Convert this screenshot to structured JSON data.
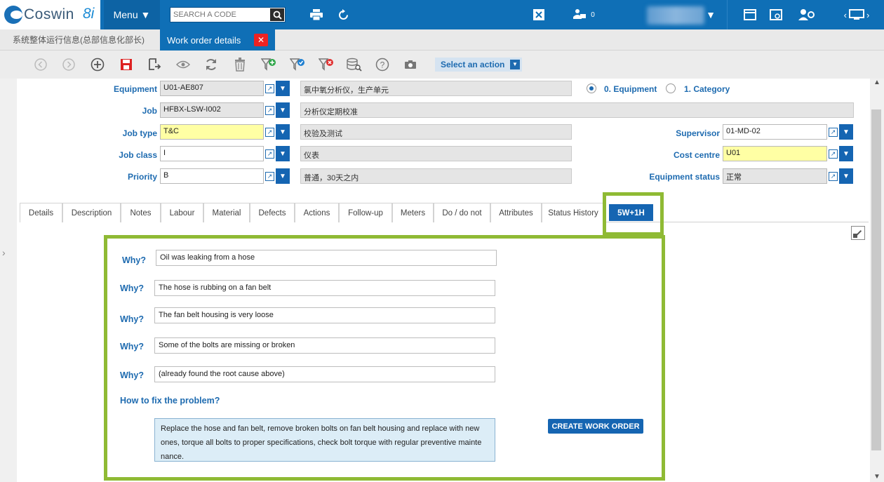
{
  "app": {
    "logo_text": "Coswin",
    "logo_version": "8i",
    "menu_label": "Menu ▼"
  },
  "search": {
    "placeholder": "SEARCH A CODE"
  },
  "topbar": {
    "badge_count": "0"
  },
  "window_tabs": [
    {
      "label": "系统整体运行信息(总部信息化部长)"
    },
    {
      "label": "Work order details"
    }
  ],
  "toolbar": {
    "action_select": "Select an action"
  },
  "form": {
    "equipment": {
      "label": "Equipment",
      "value": "U01-AE807",
      "desc": "氯中氧分析仪，生产单元"
    },
    "job": {
      "label": "Job",
      "value": "HFBX-LSW-I002",
      "desc": "分析仪定期校准"
    },
    "job_type": {
      "label": "Job type",
      "value": "T&C",
      "desc": "校验及测试"
    },
    "job_class": {
      "label": "Job class",
      "value": "I",
      "desc": "仪表"
    },
    "priority": {
      "label": "Priority",
      "value": "B",
      "desc": "普通，30天之内"
    },
    "radio_equipment": "0. Equipment",
    "radio_category": "1. Category",
    "supervisor": {
      "label": "Supervisor",
      "value": "01-MD-02"
    },
    "cost_centre": {
      "label": "Cost centre",
      "value": "U01"
    },
    "equipment_status": {
      "label": "Equipment status",
      "value": "正常"
    }
  },
  "tabs": [
    "Details",
    "Description",
    "Notes",
    "Labour",
    "Material",
    "Defects",
    "Actions",
    "Follow-up",
    "Meters",
    "Do / do not",
    "Attributes",
    "Status History",
    "5W+1H"
  ],
  "five_why": {
    "why_label": "Why?",
    "answers": [
      "Oil was leaking from a hose",
      "The hose is rubbing on a fan belt",
      "The fan belt housing is very loose",
      "Some of the bolts are missing or broken",
      "(already found the root cause above)"
    ],
    "how_label": "How to fix the problem?",
    "fix_text": "Replace the hose and fan belt, remove broken bolts on fan belt housing and replace with new ones, torque all bolts to proper specifications, check bolt torque with regular preventive mainte nance.",
    "create_button": "CREATE WORK ORDER"
  }
}
